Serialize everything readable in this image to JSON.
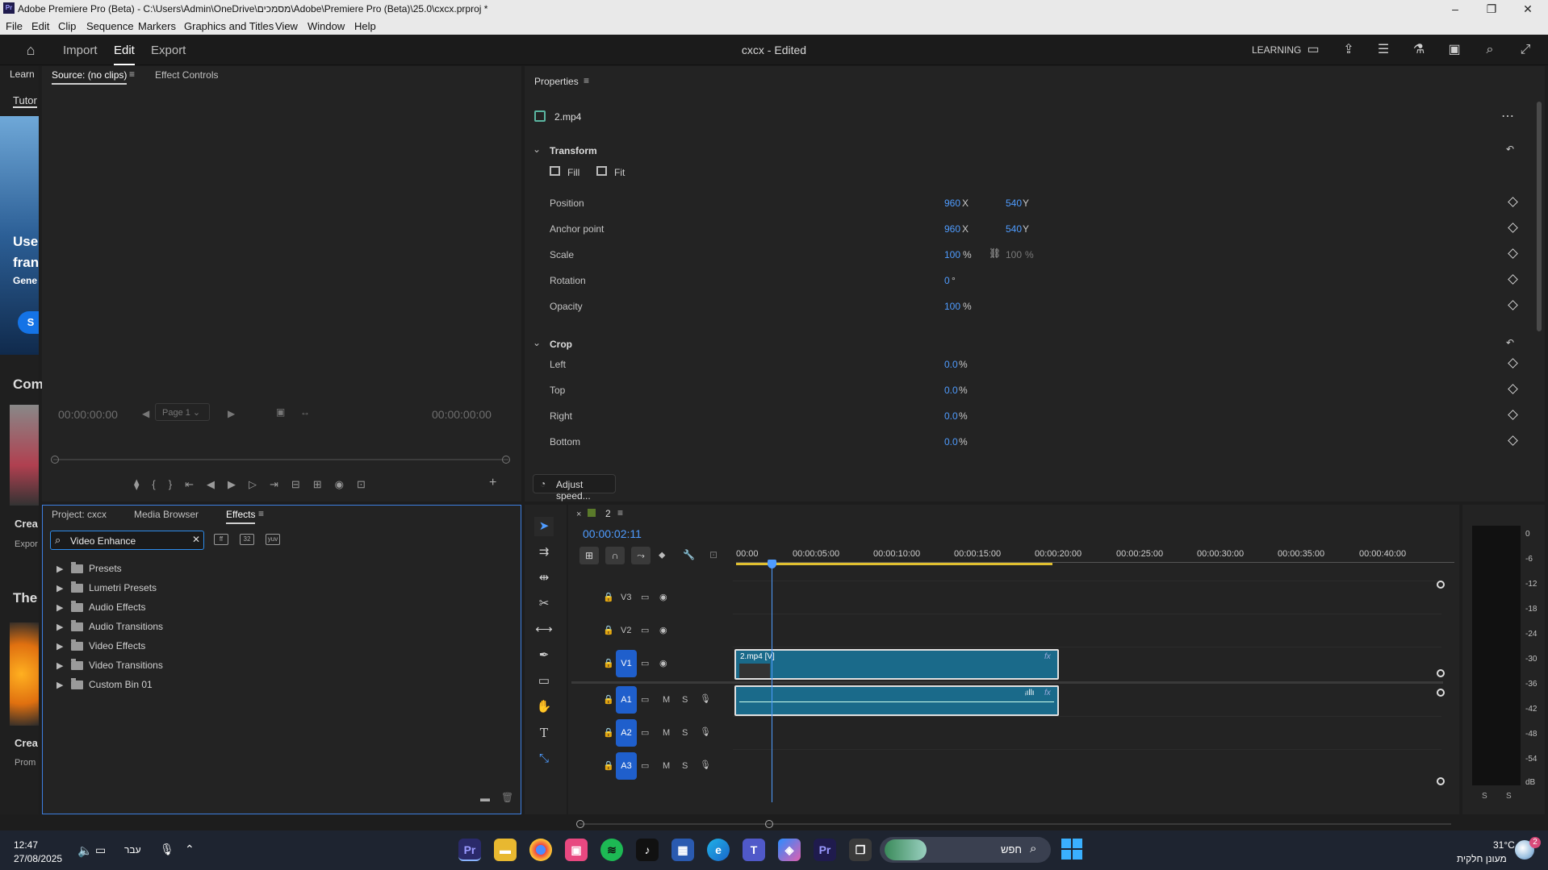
{
  "window": {
    "title": "Adobe Premiere Pro (Beta) - C:\\Users\\Admin\\OneDrive\\מסמכים\\Adobe\\Premiere Pro (Beta)\\25.0\\cxcx.prproj *",
    "logo": "Pr",
    "minimize": "–",
    "restore": "❐",
    "close": "✕"
  },
  "menu": [
    "File",
    "Edit",
    "Clip",
    "Sequence",
    "Markers",
    "Graphics and Titles",
    "View",
    "Window",
    "Help"
  ],
  "header": {
    "tabs": [
      "Import",
      "Edit",
      "Export"
    ],
    "active_tab": "Edit",
    "document_title": "cxcx - Edited",
    "workspace": "LEARNING"
  },
  "learn_panel": {
    "tabs": [
      "Learn",
      "Tutor"
    ],
    "snippets": [
      "Use",
      "fran",
      "Gene",
      "S",
      "Com",
      "Crea",
      "Expor",
      "The",
      "Crea",
      "Prom"
    ]
  },
  "source_monitor": {
    "tabs": [
      "Source: (no clips)",
      "Effect Controls"
    ],
    "timecode_in": "00:00:00:00",
    "timecode_out": "00:00:00:00",
    "page": "Page 1"
  },
  "properties": {
    "title": "Properties",
    "clip_name": "2.mp4",
    "transform": {
      "title": "Transform",
      "fill": "Fill",
      "fit": "Fit",
      "rows": [
        {
          "label": "Position",
          "v1": "960",
          "u1": "X",
          "v2": "540",
          "u2": "Y"
        },
        {
          "label": "Anchor point",
          "v1": "960",
          "u1": "X",
          "v2": "540",
          "u2": "Y"
        },
        {
          "label": "Scale",
          "v1": "100",
          "u1": "%",
          "v2": "100",
          "u2": "%"
        },
        {
          "label": "Rotation",
          "v1": "0",
          "u1": "°"
        },
        {
          "label": "Opacity",
          "v1": "100",
          "u1": "%"
        }
      ]
    },
    "crop": {
      "title": "Crop",
      "rows": [
        {
          "label": "Left",
          "v1": "0.0",
          "u1": "%"
        },
        {
          "label": "Top",
          "v1": "0.0",
          "u1": "%"
        },
        {
          "label": "Right",
          "v1": "0.0",
          "u1": "%"
        },
        {
          "label": "Bottom",
          "v1": "0.0",
          "u1": "%"
        }
      ]
    },
    "adjust_speed": "Adjust speed..."
  },
  "effects_panel": {
    "tabs": [
      "Project: cxcx",
      "Media Browser",
      "Effects"
    ],
    "search_value": "Video Enhance",
    "items": [
      "Presets",
      "Lumetri Presets",
      "Audio Effects",
      "Audio Transitions",
      "Video Effects",
      "Video Transitions",
      "Custom Bin 01"
    ]
  },
  "timeline": {
    "sequence_name": "2",
    "timecode": "00:00:02:11",
    "ruler": [
      "00:00",
      "00:00:05:00",
      "00:00:10:00",
      "00:00:15:00",
      "00:00:20:00",
      "00:00:25:00",
      "00:00:30:00",
      "00:00:35:00",
      "00:00:40:00"
    ],
    "video_tracks": [
      "V3",
      "V2",
      "V1"
    ],
    "audio_tracks": [
      "A1",
      "A2",
      "A3"
    ],
    "mute": "M",
    "solo": "S",
    "video_clip": "2.mp4 [V]",
    "fx_badge": "fx"
  },
  "audio_meter": {
    "scale": [
      "0",
      "-6",
      "-12",
      "-18",
      "-24",
      "-30",
      "-36",
      "-42",
      "-48",
      "-54",
      "dB"
    ],
    "solo_left": "S",
    "solo_right": "S"
  },
  "taskbar": {
    "time": "12:47",
    "date": "27/08/2025",
    "language": "עבר",
    "search": "חפש",
    "weather_temp": "31°C",
    "weather_desc": "מעונן חלקית",
    "notification_count": "2"
  },
  "colors": {
    "accent_blue": "#2d8ceb",
    "clip_teal": "#1a6a8a",
    "track_badge": "#1f5fcc",
    "playhead": "#4f9cff"
  }
}
